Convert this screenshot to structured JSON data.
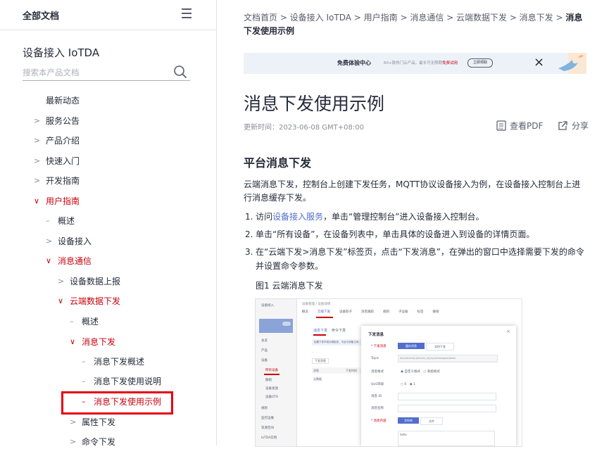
{
  "sidebar": {
    "top_title": "全部文档",
    "product_title": "设备接入 IoTDA",
    "search_placeholder": "搜索本产品文档",
    "items": [
      {
        "label": "最新动态",
        "prefix": "",
        "active": false
      },
      {
        "label": "服务公告",
        "prefix": ">",
        "active": false
      },
      {
        "label": "产品介绍",
        "prefix": ">",
        "active": false
      },
      {
        "label": "快速入门",
        "prefix": ">",
        "active": false
      },
      {
        "label": "开发指南",
        "prefix": ">",
        "active": false
      },
      {
        "label": "用户指南",
        "prefix": "∨",
        "active": true
      },
      {
        "label": "概述",
        "prefix": "–",
        "active": false
      },
      {
        "label": "设备接入",
        "prefix": ">",
        "active": false
      },
      {
        "label": "消息通信",
        "prefix": "∨",
        "active": true
      },
      {
        "label": "设备数据上报",
        "prefix": ">",
        "active": false
      },
      {
        "label": "云端数据下发",
        "prefix": "∨",
        "active": true
      },
      {
        "label": "概述",
        "prefix": "–",
        "active": false
      },
      {
        "label": "消息下发",
        "prefix": "∨",
        "active": true
      },
      {
        "label": "消息下发概述",
        "prefix": "–",
        "active": false
      },
      {
        "label": "消息下发使用说明",
        "prefix": "–",
        "active": false
      },
      {
        "label": "消息下发使用示例",
        "prefix": "–",
        "active": true
      },
      {
        "label": "属性下发",
        "prefix": ">",
        "active": false
      },
      {
        "label": "命令下发",
        "prefix": ">",
        "active": false
      }
    ]
  },
  "main": {
    "breadcrumb_text": "文档首页 > 设备接入 IoTDA > 用户指南 > 消息通信 > 云端数据下发 > 消息下发 > ",
    "breadcrumb_current": "消息下发使用示例",
    "banner": {
      "title": "免费体验中心",
      "subtitle_prefix": "60+款热门云产品，最长可无限期",
      "subtitle_highlight": "免费试用",
      "button": "立即领取",
      "close": "×"
    },
    "page_title": "消息下发使用示例",
    "updated": "更新时间：2023-06-08 GMT+08:00",
    "view_pdf": "查看PDF",
    "share": "分享",
    "section_title": "平台消息下发",
    "intro": "云端消息下发，控制台上创建下发任务，MQTT协议设备接入为例，在设备接入控制台上进行消息缓存下发。",
    "steps": [
      {
        "num": "1.",
        "pre": "访问",
        "link": "设备接入服务",
        "post": "，单击“管理控制台”进入设备接入控制台。"
      },
      {
        "num": "2.",
        "pre": "单击“所有设备”，在设备列表中，单击具体的设备进入到设备的详情页面。",
        "link": "",
        "post": ""
      },
      {
        "num": "3.",
        "pre": "在“云端下发>消息下发”标签页，点击“下发消息”，在弹出的窗口中选择需要下发的命令并设置命令参数。",
        "link": "",
        "post": ""
      }
    ],
    "figure_caption": "图1 云端消息下发",
    "screenshot": {
      "left_title": "设备接入",
      "left_items": [
        "总览",
        "产品",
        "设备",
        "所有设备",
        "群组",
        "设备发放",
        "设备OTA"
      ],
      "left_items_lower": [
        "规则",
        "监控运维",
        "资源空间",
        "IoTDA实例"
      ],
      "breadcrumb": "设备管理 / 设备详情",
      "tabs": [
        "概览",
        "云端下发",
        "设备影子",
        "消息跟踪",
        "规则",
        "子设备",
        "标签",
        "群组"
      ],
      "subtabs": [
        "消息下发",
        "命令下发"
      ],
      "notice": "如果下发不成功请检查，平台与设备之间...",
      "send_button": "下发消息",
      "table_headers": [
        "消息",
        "下发时间"
      ],
      "empty": "无数据",
      "modal": {
        "title": "下发消息",
        "close": "×",
        "fields": [
          {
            "label": "* 下发消息",
            "options": [
              "缓存消息",
              "实时下发"
            ]
          },
          {
            "label": "Topic",
            "value": "$oc/devices/{device_id}/sys/messages/down"
          },
          {
            "label": "消息格式",
            "options": [
              "自定义格式",
              "系统格式"
            ]
          },
          {
            "label": "QoS等级",
            "options": [
              "0",
              "1"
            ]
          },
          {
            "label": "消息 ID",
            "value": ""
          },
          {
            "label": "消息名称",
            "value": ""
          },
          {
            "label": "* 消息内容",
            "options": [
              "字符串",
              "文件"
            ]
          }
        ],
        "content_value": "hello"
      }
    }
  },
  "colors": {
    "accent_red": "#c7000b",
    "link_blue": "#526ecc",
    "highlight_box": "#e60012"
  }
}
